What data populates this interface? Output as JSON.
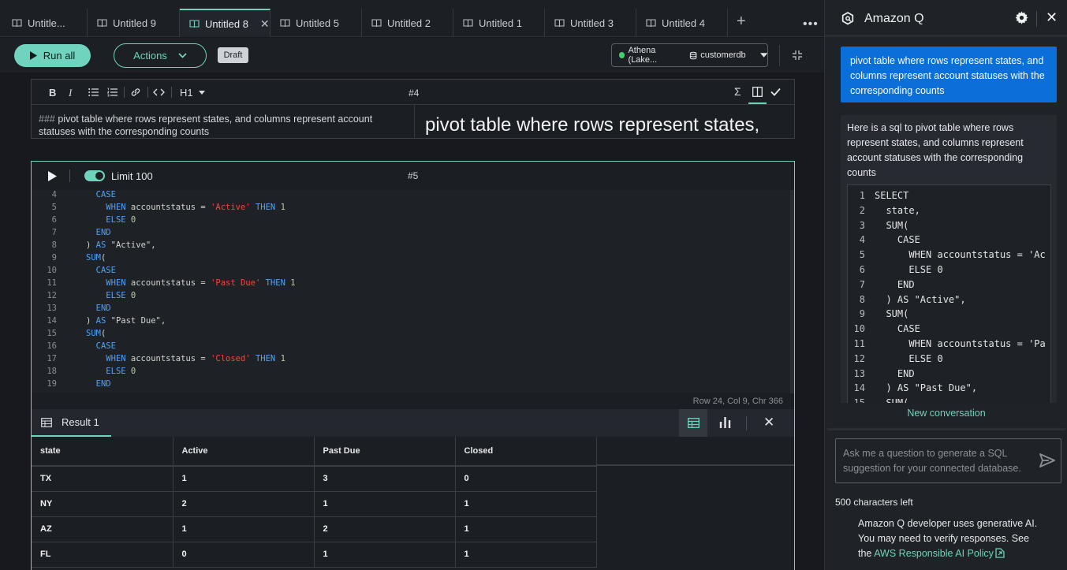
{
  "tabs": [
    {
      "label": "Untitle..."
    },
    {
      "label": "Untitled 9"
    },
    {
      "label": "Untitled 8",
      "active": true
    },
    {
      "label": "Untitled 5"
    },
    {
      "label": "Untitled 2"
    },
    {
      "label": "Untitled 1"
    },
    {
      "label": "Untitled 3"
    },
    {
      "label": "Untitled 4"
    }
  ],
  "toolbar": {
    "run_all": "Run all",
    "actions": "Actions",
    "draft": "Draft",
    "connection": "Athena (Lake...",
    "database": "customerdb"
  },
  "md_cell": {
    "number": "#4",
    "heading": "H1",
    "source_hash": "###",
    "source_text": "pivot table where rows represent states, and columns represent account statuses with the corresponding counts",
    "preview": "pivot table where rows represent states,"
  },
  "sql_cell": {
    "number": "#5",
    "limit": "Limit 100",
    "lines": [
      {
        "n": "4",
        "t": "    CASE"
      },
      {
        "n": "5",
        "t": "      WHEN accountstatus = 'Active' THEN 1"
      },
      {
        "n": "6",
        "t": "      ELSE 0"
      },
      {
        "n": "7",
        "t": "    END"
      },
      {
        "n": "8",
        "t": "  ) AS \"Active\","
      },
      {
        "n": "9",
        "t": "  SUM("
      },
      {
        "n": "10",
        "t": "    CASE"
      },
      {
        "n": "11",
        "t": "      WHEN accountstatus = 'Past Due' THEN 1"
      },
      {
        "n": "12",
        "t": "      ELSE 0"
      },
      {
        "n": "13",
        "t": "    END"
      },
      {
        "n": "14",
        "t": "  ) AS \"Past Due\","
      },
      {
        "n": "15",
        "t": "  SUM("
      },
      {
        "n": "16",
        "t": "    CASE"
      },
      {
        "n": "17",
        "t": "      WHEN accountstatus = 'Closed' THEN 1"
      },
      {
        "n": "18",
        "t": "      ELSE 0"
      },
      {
        "n": "19",
        "t": "    END"
      }
    ],
    "status": "Row 24,  Col 9,  Chr 366"
  },
  "result": {
    "tab_label": "Result 1",
    "columns": [
      "state",
      "Active",
      "Past Due",
      "Closed"
    ],
    "rows": [
      [
        "TX",
        "1",
        "3",
        "0"
      ],
      [
        "NY",
        "2",
        "1",
        "1"
      ],
      [
        "AZ",
        "1",
        "2",
        "1"
      ],
      [
        "FL",
        "0",
        "1",
        "1"
      ]
    ]
  },
  "amazon_q": {
    "title": "Amazon Q",
    "user_message": "pivot table where rows represent states, and columns represent account statuses with the corresponding counts",
    "assistant_intro": "Here is a sql to pivot table where rows represent states, and columns represent account statuses with the corresponding counts",
    "code_lines": [
      {
        "n": "1",
        "t": "SELECT"
      },
      {
        "n": "2",
        "t": "  state,"
      },
      {
        "n": "3",
        "t": "  SUM("
      },
      {
        "n": "4",
        "t": "    CASE"
      },
      {
        "n": "5",
        "t": "      WHEN accountstatus = 'Ac"
      },
      {
        "n": "6",
        "t": "      ELSE 0"
      },
      {
        "n": "7",
        "t": "    END"
      },
      {
        "n": "8",
        "t": "  ) AS \"Active\","
      },
      {
        "n": "9",
        "t": "  SUM("
      },
      {
        "n": "10",
        "t": "    CASE"
      },
      {
        "n": "11",
        "t": "      WHEN accountstatus = 'Pa"
      },
      {
        "n": "12",
        "t": "      ELSE 0"
      },
      {
        "n": "13",
        "t": "    END"
      },
      {
        "n": "14",
        "t": "  ) AS \"Past Due\","
      },
      {
        "n": "15",
        "t": "  SUM("
      }
    ],
    "new_conversation": "New conversation",
    "input_placeholder": "Ask me a question to generate a SQL suggestion for your connected database.",
    "chars_left": "500 characters left",
    "disclaimer_text": "Amazon Q developer uses generative AI. You may need to verify responses. See the",
    "policy_link": "AWS Responsible AI Policy"
  },
  "colors": {
    "accent": "#6fd3bd",
    "user_bubble": "#0a6fd9",
    "keyword": "#4da3ff",
    "string": "#f0483e"
  }
}
